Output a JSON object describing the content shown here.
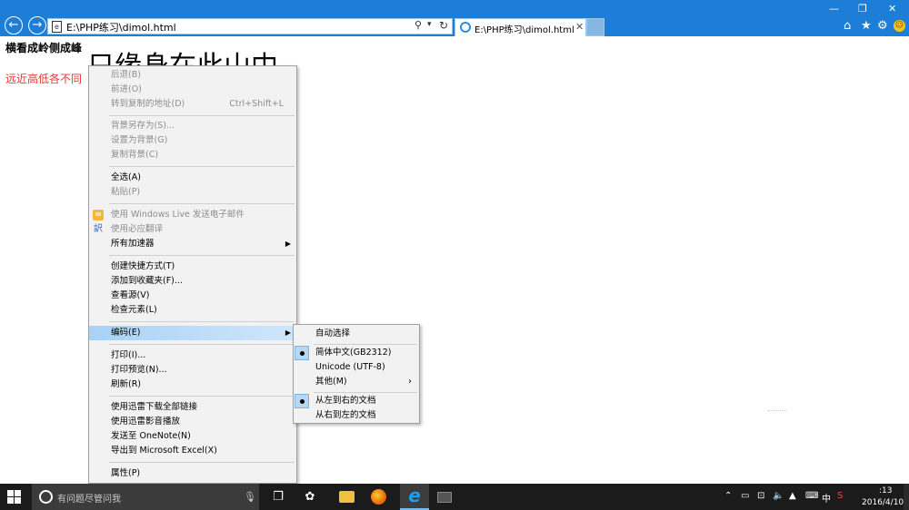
{
  "browser": {
    "address": "E:\\PHP练习\\dimol.html",
    "tab_title": "E:\\PHP练习\\dimol.html",
    "search_glyph": "⚲",
    "drop_glyph": "▾",
    "refresh_glyph": "↻"
  },
  "page": {
    "heading": "横看成岭侧成峰",
    "big_text": "只缘身在此山中",
    "red_text": "远近高低各不同",
    "red_color": "#e53935"
  },
  "context_menu": {
    "back": "后退(B)",
    "forward": "前进(O)",
    "goto_copied": "转到复制的地址(D)",
    "goto_shortcut": "Ctrl+Shift+L",
    "save_bg": "背景另存为(S)...",
    "set_bg": "设置为背景(G)",
    "copy_bg": "复制背景(C)",
    "select_all": "全选(A)",
    "paste": "粘贴(P)",
    "windows_live": "使用 Windows Live 发送电子邮件",
    "bing_translate": "使用必应翻译",
    "accelerators": "所有加速器",
    "create_shortcut": "创建快捷方式(T)",
    "add_favorites": "添加到收藏夹(F)...",
    "view_source": "查看源(V)",
    "inspect": "检查元素(L)",
    "encoding": "编码(E)",
    "print": "打印(I)...",
    "print_preview": "打印预览(N)...",
    "refresh": "刷新(R)",
    "thunder_all": "使用迅雷下载全部链接",
    "thunder_play": "使用迅雷影音播放",
    "onenote": "发送至 OneNote(N)",
    "excel": "导出到 Microsoft Excel(X)",
    "properties": "属性(P)"
  },
  "encoding_submenu": {
    "auto": "自动选择",
    "gb2312": "简体中文(GB2312)",
    "utf8": "Unicode (UTF-8)",
    "other": "其他(M)",
    "ltr": "从左到右的文档",
    "rtl": "从右到左的文档",
    "selected_encoding": "简体中文(GB2312)",
    "selected_direction": "从左到右的文档"
  },
  "taskbar": {
    "search_placeholder": "有问题尽管问我",
    "clock_time": ":13",
    "clock_date": "2016/4/10",
    "tray_lang": "中"
  },
  "icons": {
    "back": "back-arrow-icon",
    "forward": "forward-arrow-icon",
    "home": "home-icon",
    "favorites": "star-icon",
    "settings": "gear-icon",
    "feedback": "smiley-icon"
  }
}
